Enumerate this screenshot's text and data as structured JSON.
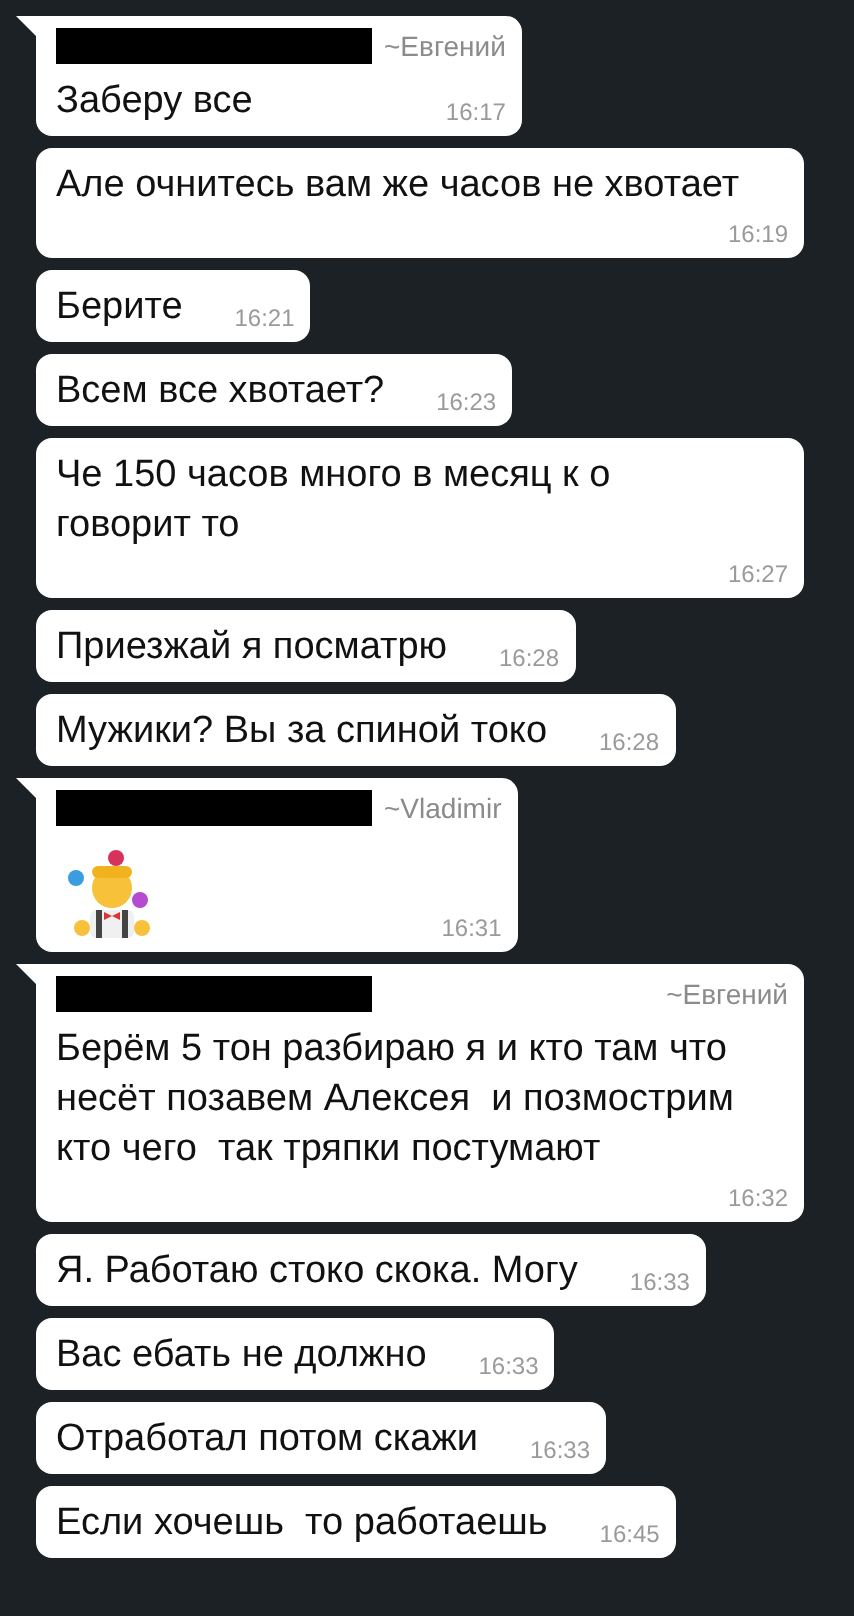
{
  "groups": [
    {
      "sender": "~Евгений",
      "redacted": true,
      "messages": [
        {
          "kind": "text",
          "text": "Заберу все",
          "time": "16:17"
        },
        {
          "kind": "text",
          "text": "Але очнитесь вам же часов не хвотает",
          "time": "16:19"
        },
        {
          "kind": "text",
          "text": "Берите",
          "time": "16:21"
        },
        {
          "kind": "text",
          "text": "Всем все хвотает?",
          "time": "16:23"
        },
        {
          "kind": "text",
          "text": "Че 150 часов много в месяц к о говорит то",
          "time": "16:27"
        },
        {
          "kind": "text",
          "text": "Приезжай я посматрю",
          "time": "16:28"
        },
        {
          "kind": "text",
          "text": "Мужики? Вы за спиной токо",
          "time": "16:28"
        }
      ]
    },
    {
      "sender": "~Vladimir",
      "redacted": true,
      "messages": [
        {
          "kind": "emoji",
          "time": "16:31"
        }
      ]
    },
    {
      "sender": "~Евгений",
      "redacted": true,
      "messages": [
        {
          "kind": "text",
          "text": "Берём 5 тон разбираю я и кто там что несёт позавем Алексея  и позмострим кто чего  так тряпки постумают",
          "time": "16:32"
        },
        {
          "kind": "text",
          "text": "Я. Работаю стоко скока. Могу",
          "time": "16:33"
        },
        {
          "kind": "text",
          "text": "Вас ебать не должно",
          "time": "16:33"
        },
        {
          "kind": "text",
          "text": "Отработал потом скажи",
          "time": "16:33"
        },
        {
          "kind": "text",
          "text": "Если хочешь  то работаешь",
          "time": "16:45"
        }
      ]
    }
  ]
}
